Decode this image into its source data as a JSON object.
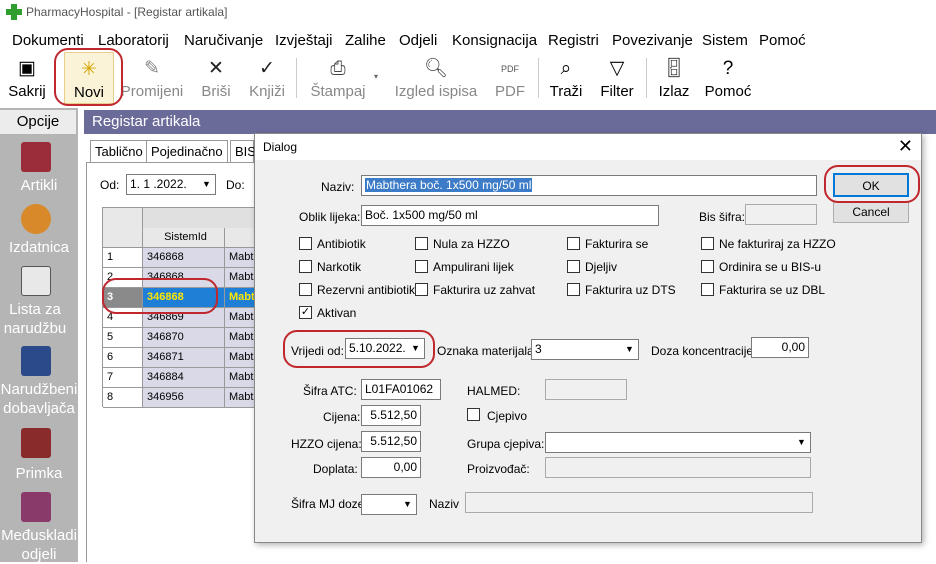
{
  "window": {
    "title": "PharmacyHospital - [Registar artikala]"
  },
  "menu": [
    "Dokumenti",
    "Laboratorij",
    "Naručivanje",
    "Izvještaji",
    "Zalihe",
    "Odjeli",
    "Konsignacija",
    "Registri",
    "Povezivanje",
    "Sistem",
    "Pomoć"
  ],
  "toolbar": {
    "sakrij": "Sakrij",
    "novi": "Novi",
    "promijeni": "Promijeni",
    "brisi": "Briši",
    "knjizi": "Knjiži",
    "stampaj": "Štampaj",
    "izgled": "Izgled ispisa",
    "pdf": "PDF",
    "pdf_icon": "PDF",
    "trazi": "Traži",
    "filter": "Filter",
    "izlaz": "Izlaz",
    "pomoc": "Pomoć"
  },
  "sidebar": {
    "header": "Opcije",
    "items": [
      {
        "label": "Artikli",
        "icon": "book-icon"
      },
      {
        "label": "Izdatnica",
        "icon": "box-icon"
      },
      {
        "label": "Lista za narudžbu",
        "icon": "documents-icon"
      },
      {
        "label": "Narudžbeni dobavljača",
        "icon": "notebook-icon"
      },
      {
        "label": "Primka",
        "icon": "receipt-icon"
      },
      {
        "label": "Međuskladi odjeli",
        "icon": "transfer-icon"
      }
    ]
  },
  "main": {
    "title": "Registar artikala",
    "tabs": [
      "Tablično",
      "Pojedinačno",
      "BIS"
    ],
    "od_label": "Od:",
    "od_value": "1. 1 .2022.",
    "do_label": "Do:",
    "grid_header": "SistemId",
    "rows": [
      {
        "n": "1",
        "id": "346868",
        "name": "Mabth"
      },
      {
        "n": "2",
        "id": "346868",
        "name": "Mabth"
      },
      {
        "n": "3",
        "id": "346868",
        "name": "Mabt"
      },
      {
        "n": "4",
        "id": "346869",
        "name": "Mabth"
      },
      {
        "n": "5",
        "id": "346870",
        "name": "Mabth"
      },
      {
        "n": "6",
        "id": "346871",
        "name": "Mabth"
      },
      {
        "n": "7",
        "id": "346884",
        "name": "Mabth"
      },
      {
        "n": "8",
        "id": "346956",
        "name": "Mabth"
      }
    ]
  },
  "dialog": {
    "title": "Dialog",
    "naziv_label": "Naziv:",
    "naziv_value": "Mabthera boč. 1x500 mg/50 ml",
    "oblik_label": "Oblik lijeka:",
    "oblik_value": "Boč. 1x500 mg/50 ml",
    "bis_label": "Bis šifra:",
    "bis_value": "",
    "ok": "OK",
    "cancel": "Cancel",
    "checkboxes": [
      {
        "label": "Antibiotik",
        "checked": false
      },
      {
        "label": "Nula za HZZO",
        "checked": false
      },
      {
        "label": "Fakturira se",
        "checked": false
      },
      {
        "label": "Ne fakturiraj za HZZO",
        "checked": false
      },
      {
        "label": "Narkotik",
        "checked": false
      },
      {
        "label": "Ampulirani lijek",
        "checked": false
      },
      {
        "label": "Djeljiv",
        "checked": false
      },
      {
        "label": "Ordinira se u BIS-u",
        "checked": false
      },
      {
        "label": "Rezervni antibiotik",
        "checked": false
      },
      {
        "label": "Fakturira uz zahvat",
        "checked": false
      },
      {
        "label": "Fakturira uz DTS",
        "checked": false
      },
      {
        "label": "Fakturira se uz DBL",
        "checked": false
      },
      {
        "label": "Aktivan",
        "checked": true
      }
    ],
    "vrijedi_label": "Vrijedi od:",
    "vrijedi_value": "5.10.2022.",
    "oznaka_label": "Oznaka materijala:",
    "oznaka_value": "3",
    "doza_label": "Doza koncentracije:",
    "doza_value": "0,00",
    "atc_label": "Šifra ATC:",
    "atc_value": "L01FA01062",
    "halmed_label": "HALMED:",
    "cijena_label": "Cijena:",
    "cijena_value": "5.512,50",
    "cjepivo_label": "Cjepivo",
    "hzzo_label": "HZZO cijena:",
    "hzzo_value": "5.512,50",
    "grupa_label": "Grupa cjepiva:",
    "doplata_label": "Doplata:",
    "doplata_value": "0,00",
    "proizvodac_label": "Proizvođač:",
    "sifra_mj_label": "Šifra MJ doze",
    "naziv2_label": "Naziv"
  }
}
